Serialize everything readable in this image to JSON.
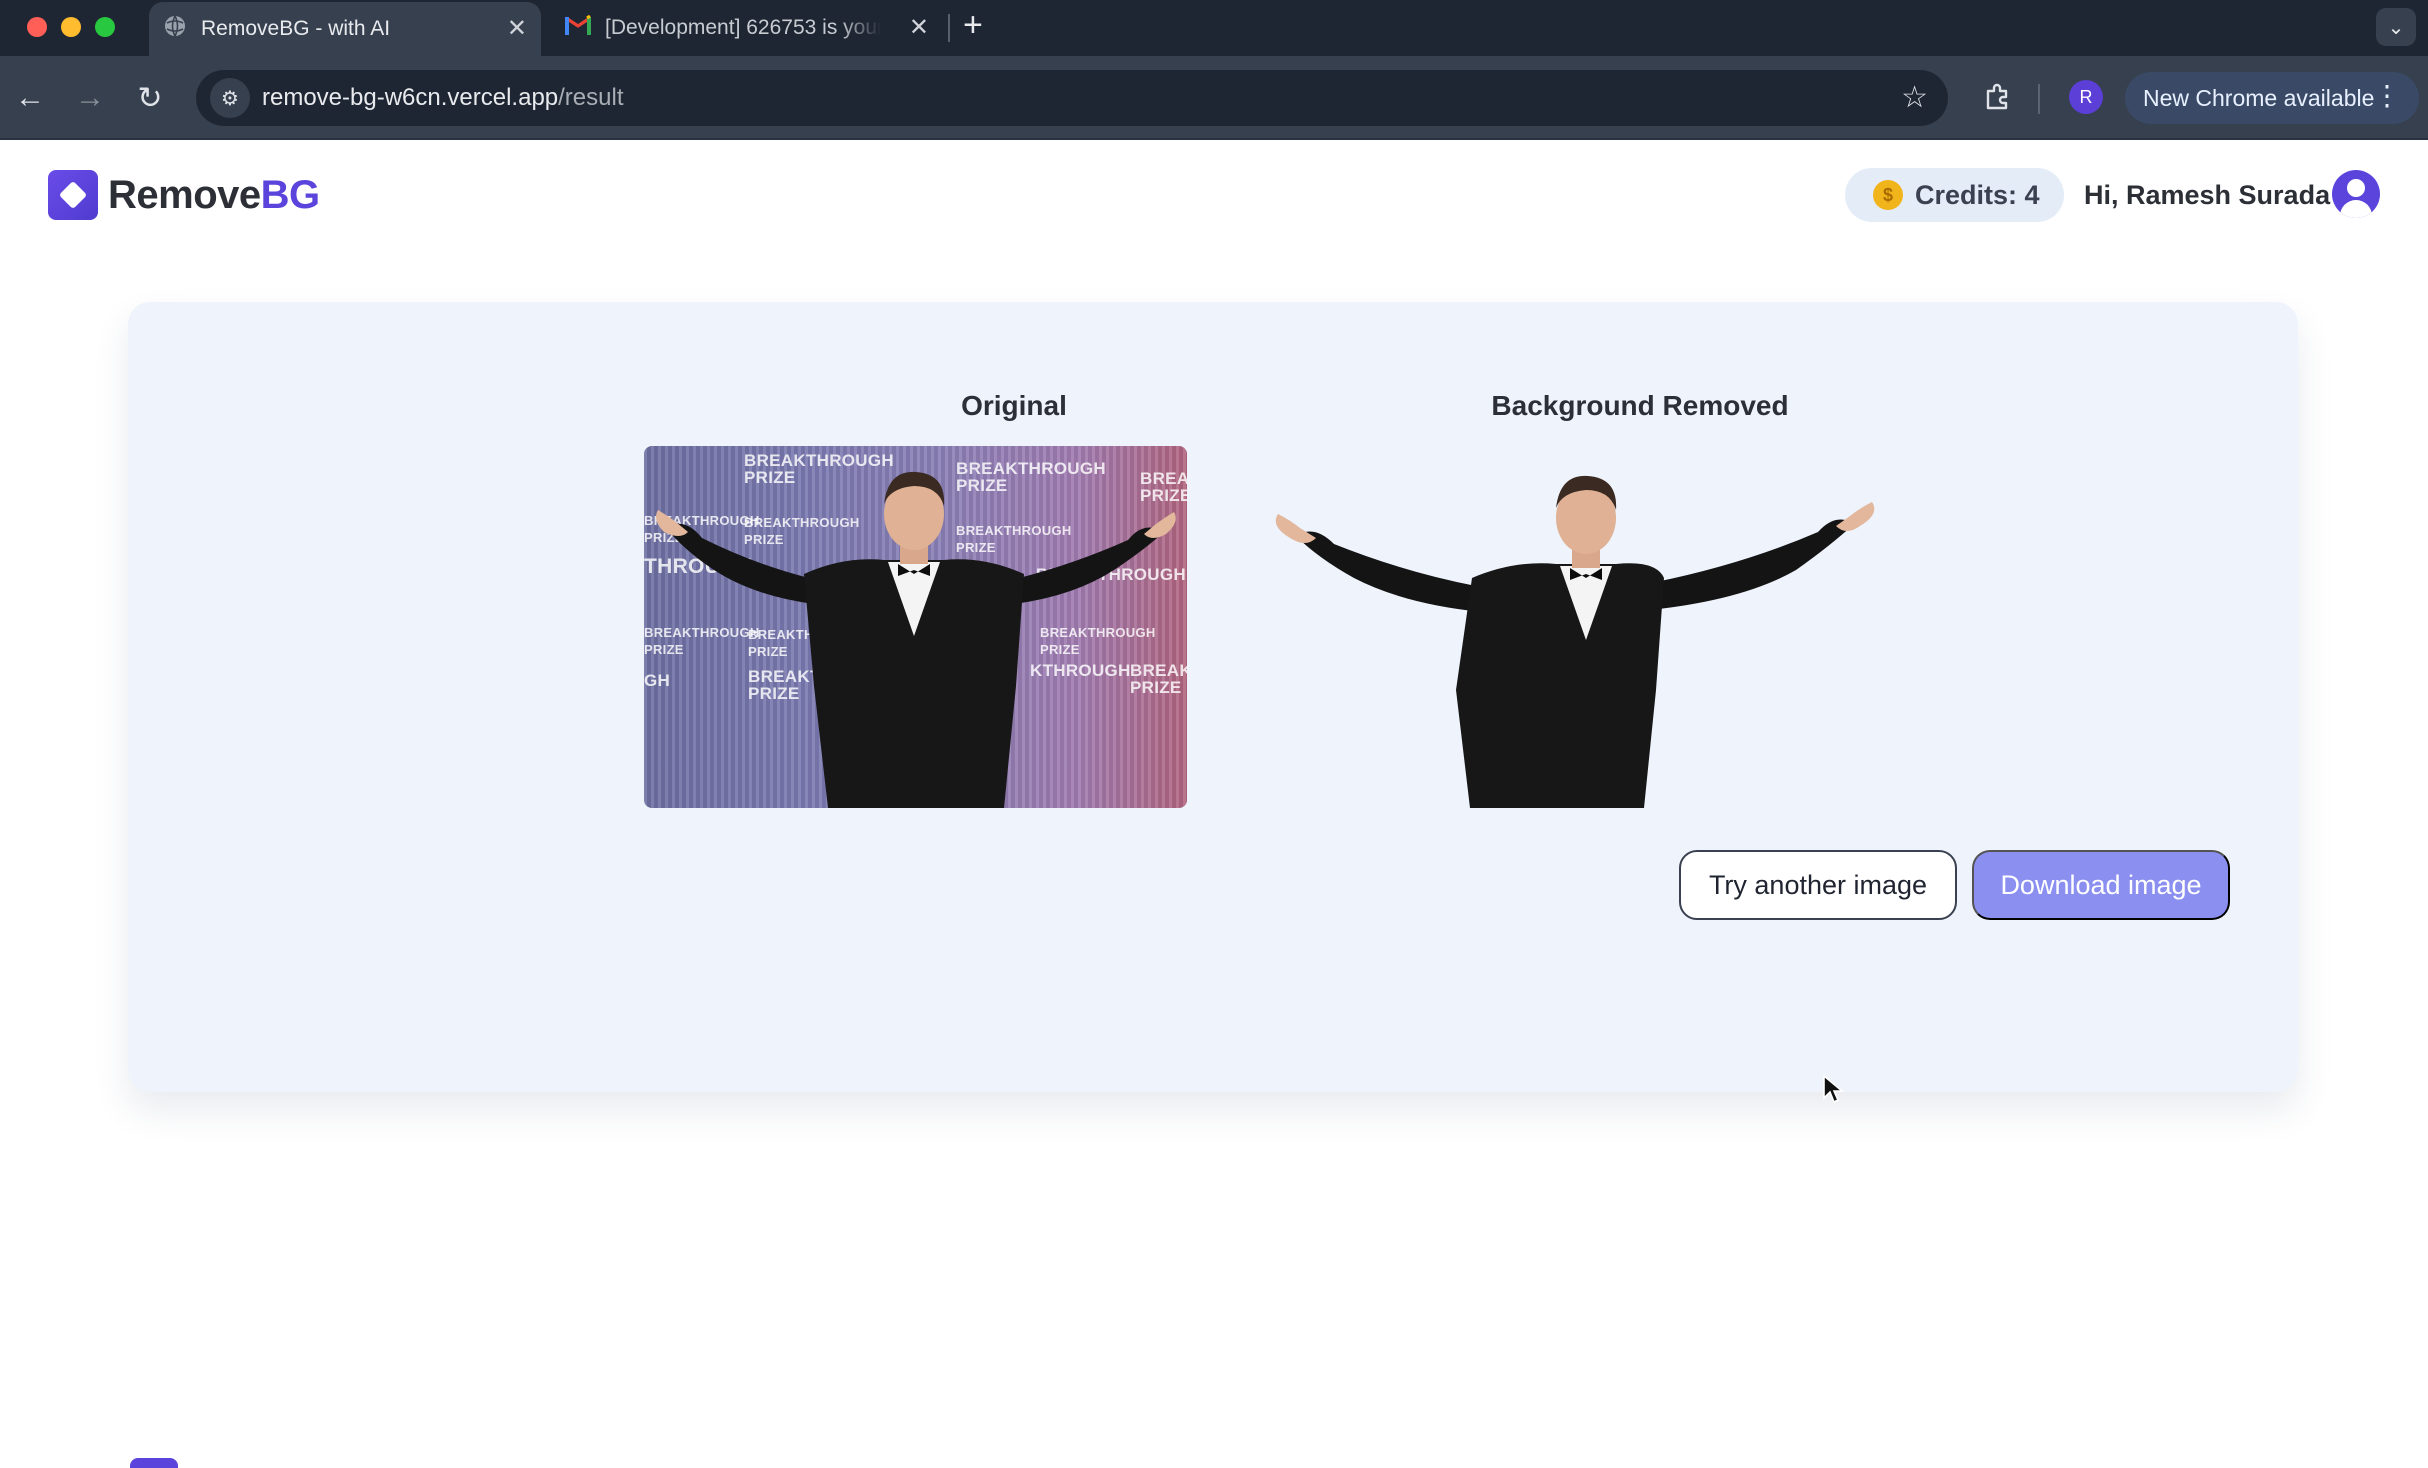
{
  "browser": {
    "tabs": [
      {
        "title": "RemoveBG - with AI",
        "icon": "globe-icon",
        "active": true
      },
      {
        "title": "[Development] 626753 is your",
        "icon": "gmail-icon",
        "active": false
      }
    ],
    "url_host": "remove-bg-w6cn.vercel.app",
    "url_path": "/result",
    "profile_initial": "R",
    "update_label": "New Chrome available"
  },
  "header": {
    "logo_part1": "Remove",
    "logo_part2": "BG",
    "credits_label": "Credits: 4",
    "greeting": "Hi, Ramesh Surada"
  },
  "result": {
    "original_label": "Original",
    "removed_label": "Background Removed",
    "try_another_label": "Try another image",
    "download_label": "Download image"
  },
  "colors": {
    "brand": "#5a44dc",
    "download_button": "#8b8ff0",
    "card_background": "#eef3fc"
  }
}
